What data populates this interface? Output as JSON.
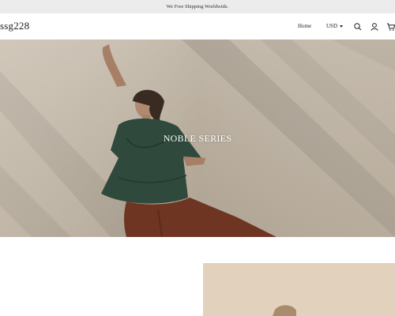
{
  "announcement": {
    "text": "We Free Shipping Worldwide."
  },
  "header": {
    "logo": "ssg228",
    "nav": {
      "home_label": "Home"
    },
    "currency": {
      "selected": "USD"
    },
    "icons": {
      "search": "search-icon",
      "account": "user-icon",
      "cart": "cart-icon"
    }
  },
  "hero": {
    "title": "NOBLE SERIES"
  },
  "colors": {
    "announcement_bg": "#ececec",
    "hero_text": "#ffffff",
    "shirt_green": "#2f4a3d",
    "pants_rust": "#6e3523"
  }
}
